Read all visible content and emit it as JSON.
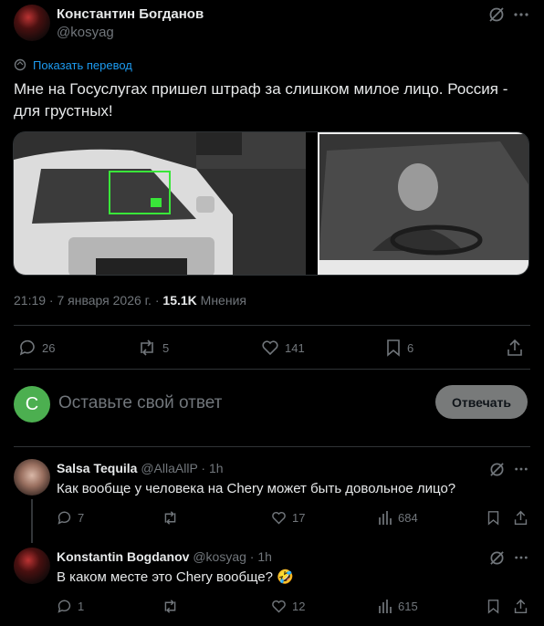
{
  "post": {
    "author_name": "Константин Богданов",
    "author_handle": "@kosyag",
    "translate_label": "Показать перевод",
    "text": "Мне на Госуслугах пришел штраф за слишком милое лицо. Россия - для грустных!",
    "time": "21:19 · 7 января 2026 г. · ",
    "views_count": "15.1K",
    "views_label": " Мнения",
    "stats": {
      "replies": "26",
      "reposts": "5",
      "likes": "141",
      "bookmarks": "6"
    }
  },
  "reply_box": {
    "avatar_letter": "C",
    "placeholder": "Оставьте свой ответ",
    "button_label": "Отвечать",
    "avatar_color": "#4caf50"
  },
  "replies": [
    {
      "name": "Salsa Tequila",
      "handle": "@AllaAllP · 1h",
      "text": "Как вообще у человека на Chery может быть довольное лицо?",
      "replies": "7",
      "reposts": "",
      "likes": "17",
      "views": "684"
    },
    {
      "name": "Konstantin Bogdanov",
      "handle": "@kosyag · 1h",
      "text": "В каком месте это Chery вообще? 🤣",
      "replies": "1",
      "reposts": "",
      "likes": "12",
      "views": "615"
    }
  ],
  "colors": {
    "accent": "#1d9bf0",
    "muted": "#71767b",
    "highlight_box": "#39e639"
  }
}
